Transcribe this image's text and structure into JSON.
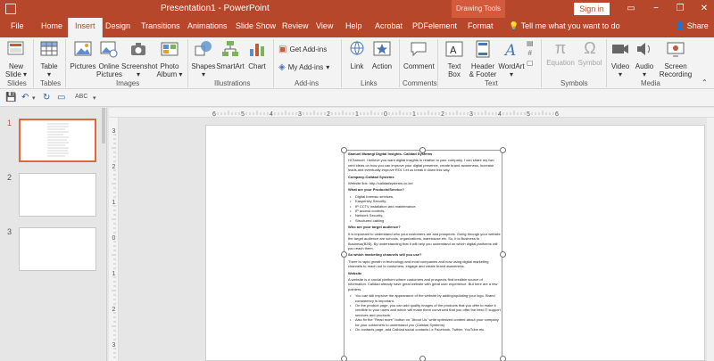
{
  "window": {
    "title": "Presentation1  -  PowerPoint",
    "context_tab": "Drawing Tools",
    "signin": "Sign in",
    "minimize": "−",
    "restore": "❐",
    "close": "✕"
  },
  "tabs": [
    "File",
    "Home",
    "Insert",
    "Design",
    "Transitions",
    "Animations",
    "Slide Show",
    "Review",
    "View",
    "Help",
    "Acrobat",
    "PDFelement",
    "Format"
  ],
  "tell_me": "Tell me what you want to do",
  "share": "Share",
  "ribbon": {
    "new_slide": "New\nSlide ▾",
    "table": "Table\n▾",
    "pictures": "Pictures",
    "online_pictures": "Online\nPictures",
    "screenshot": "Screenshot\n▾",
    "photo_album": "Photo\nAlbum ▾",
    "shapes": "Shapes\n▾",
    "smartart": "SmartArt",
    "chart": "Chart",
    "get_addins": "Get Add-ins",
    "my_addins": "My Add-ins",
    "link": "Link",
    "action": "Action",
    "comment": "Comment",
    "text_box": "Text\nBox",
    "header_footer": "Header\n& Footer",
    "wordart": "WordArt\n▾",
    "equation": "Equation",
    "symbol": "Symbol",
    "video": "Video\n▾",
    "audio": "Audio\n▾",
    "screen_recording": "Screen\nRecording",
    "groups": {
      "slides": "Slides",
      "tables": "Tables",
      "images": "Images",
      "illustrations": "Illustrations",
      "addins": "Add-ins",
      "links": "Links",
      "comments": "Comments",
      "text": "Text",
      "symbols": "Symbols",
      "media": "Media"
    }
  },
  "thumbnails": [
    "1",
    "2",
    "3"
  ],
  "ruler": {
    "h_ticks": [
      "6",
      "5",
      "4",
      "3",
      "2",
      "1",
      "0",
      "1",
      "2",
      "3",
      "4",
      "5",
      "6"
    ],
    "v_ticks": [
      "3",
      "2",
      "1",
      "0",
      "1",
      "2",
      "3"
    ]
  },
  "slide_text": {
    "heading": "Samuel Mwangi Digital Insights- Calidad Systems",
    "intro": "Hi Samuel, I believe you want digital insights in relation to your company. I can share my two cent ideas on how you can improve your digital presence, create brand awareness, increase leads and eventually improve ROI. Let us break it down this way.",
    "company_label": "Company-Calidad Systems",
    "website_line": "Website link: http://calidadsystems.co.ke/",
    "products_q": "What are your Products/Service?",
    "products": [
      "Digital forensic services,",
      "Kaspersky Security,",
      "IP CCTV installation and maintenance,",
      "IP access controls,",
      "Network Security,",
      "Structured cabling"
    ],
    "audience_q": "Who are your target audience?",
    "audience_text": "It is important to understand who your customers are and prospects. Going through your website the target audience are schools, organizations, warehouse etc. So, it is Business to Business(B2B). By understanding that it will help you understand on which digital platforms will you reach them.",
    "channels_q": "So which marketing channels will you use?",
    "channels_text": "There is rapid growth in technology and most companies and now using digital marketing channels to reach out to customers, engage and create brand awareness.",
    "website_h": "Website",
    "website_text": "A website is a crucial platform where customers and prospects find credible source of information. Calidad already have great website with great user experience. But here are a few pointers.",
    "pointers": [
      "You can still improve the appearance of the website by adding/updating your logo. Brand consistency is important.",
      "On the product page, you can add quality images of the products that you offer to make it credible to your users and which will make them convinced that you offer the best IT support services and products.",
      "Also fix the \"Read more\" button on \"About Us\" write optimized content about your company for your customers to understand you (Calidad Systems)",
      "On contacts page, add Calidad social contacts i.e Facebook, Twitter, YouTube etc."
    ]
  }
}
